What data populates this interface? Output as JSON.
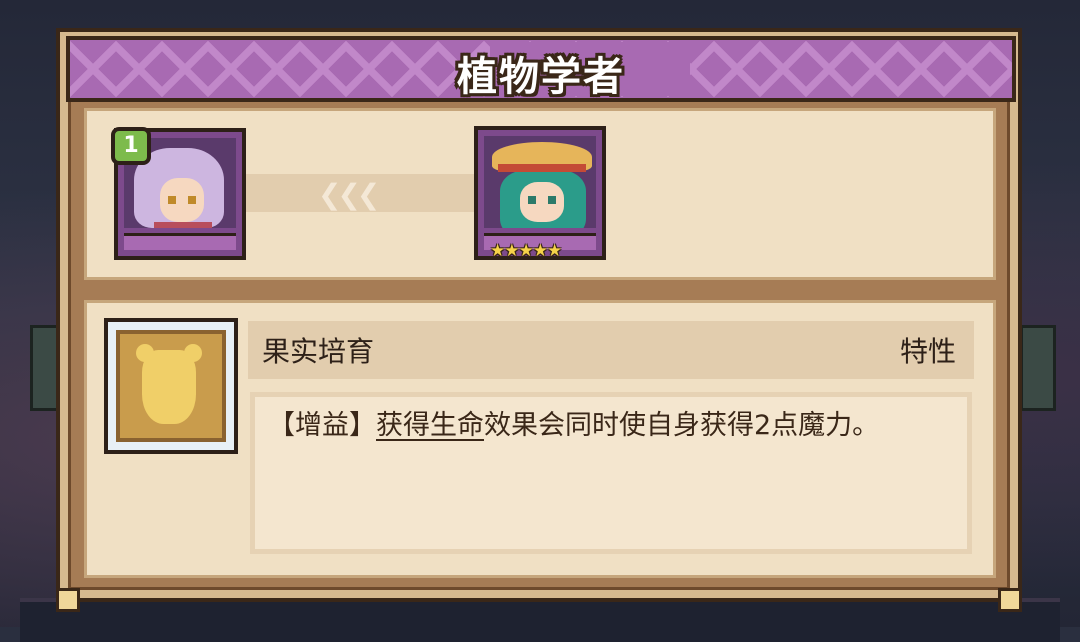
{
  "title": "植物学者",
  "source_unit": {
    "level": "1"
  },
  "target_unit": {
    "stars": "★★★★★"
  },
  "skill": {
    "name": "果实培育",
    "type": "特性",
    "desc_prefix": "【增益】",
    "desc_keyword": "获得生命",
    "desc_rest": "效果会同时使自身获得2点魔力。"
  },
  "colors": {
    "banner": "#a86ab2",
    "panel": "#f0e0c4",
    "frame": "#a67c55"
  }
}
